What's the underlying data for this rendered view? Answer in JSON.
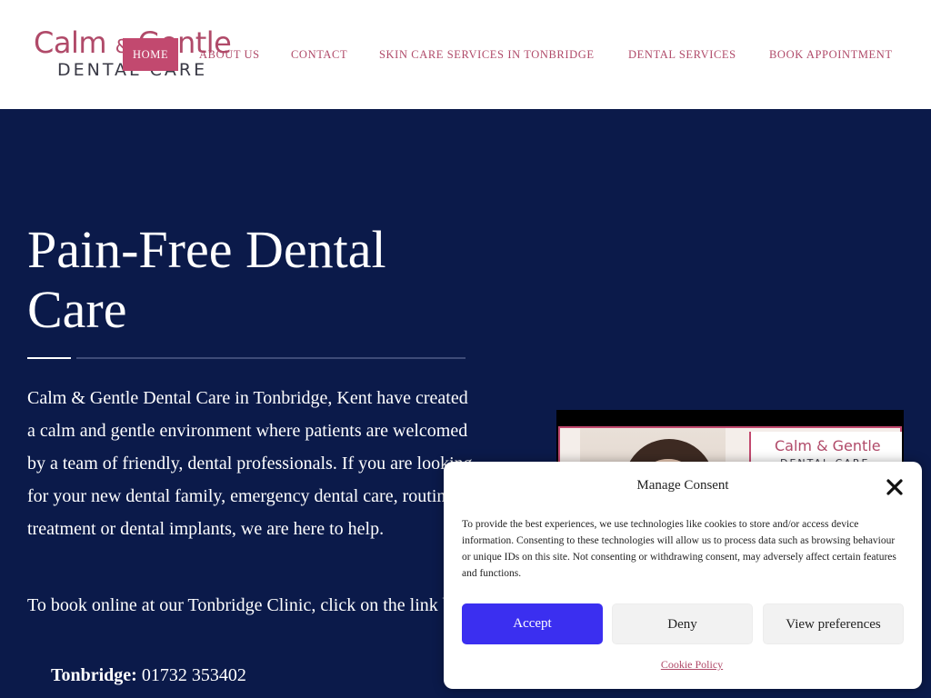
{
  "brand": {
    "logo_line1": "Calm",
    "logo_amp": "&",
    "logo_line1b": "Gentle",
    "logo_line2": "DENTAL CARE",
    "accent_color": "#c2496f",
    "navy_color": "#0b1a4a"
  },
  "nav": {
    "items": [
      {
        "label": "HOME",
        "active": true
      },
      {
        "label": "ABOUT US"
      },
      {
        "label": "CONTACT"
      },
      {
        "label": "SKIN CARE SERVICES IN TONBRIDGE"
      },
      {
        "label": "DENTAL SERVICES"
      },
      {
        "label": "BOOK APPOINTMENT"
      }
    ]
  },
  "hero": {
    "title": "Pain-Free Dental Care",
    "paragraph1": "Calm & Gentle Dental Care in Tonbridge, Kent have created a calm and gentle environment where patients are welcomed by a team of friendly, dental professionals. If you are looking for your new dental family, emergency dental care, routine treatment or dental implants, we are here to help.",
    "paragraph2": "To book online at our Tonbridge Clinic, click on the link below or telephone:",
    "phone_label": "Tonbridge:",
    "phone_number": "01732 353402"
  },
  "video": {
    "logo_line1": "Calm & Gentle",
    "logo_line2": "DENTAL CARE"
  },
  "consent": {
    "title": "Manage Consent",
    "body": "To provide the best experiences, we use technologies like cookies to store and/or access device information. Consenting to these technologies will allow us to process data such as browsing behaviour or unique IDs on this site. Not consenting or withdrawing consent, may adversely affect certain features and functions.",
    "accept_label": "Accept",
    "deny_label": "Deny",
    "prefs_label": "View preferences",
    "policy_link": "Cookie Policy"
  }
}
